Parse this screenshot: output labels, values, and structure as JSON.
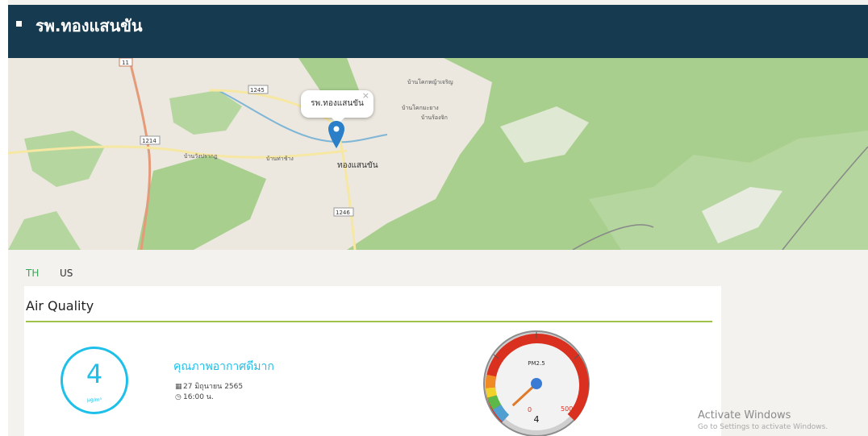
{
  "header": {
    "title": "รพ.ทองแสนขัน"
  },
  "map": {
    "popup_label": "รพ.ทองแสนขัน",
    "popup_close": "×",
    "labels": [
      "11",
      "1245",
      "1214",
      "1246",
      "ทองแสนขัน",
      "บ้านวังปรากฎ",
      "บ้านท่าช้าง",
      "บ้านโคกมะยาง",
      "บ้านโคกหญ้าเจริญ",
      "บ้านร้องจิก"
    ]
  },
  "tabs": [
    "TH",
    "US"
  ],
  "air": {
    "title": "Air Quality",
    "value": "4",
    "unit": "µg/m³",
    "quality_text": "คุณภาพอากาศดีมาก",
    "date": "27 มิถุนายน 2565",
    "time": "16:00 น."
  },
  "gauge": {
    "label": "PM2.5",
    "min": "0",
    "max": "500",
    "value": "4",
    "value_num": 4,
    "max_num": 500
  },
  "watermark": {
    "line1": "Activate Windows",
    "line2": "Go to Settings to activate Windows."
  },
  "colors": {
    "header": "#163a4f",
    "accent": "#1ec0ea",
    "tab_active": "#3aa55a",
    "rule": "#9fc24a",
    "gauge_red": "#d9301f"
  }
}
